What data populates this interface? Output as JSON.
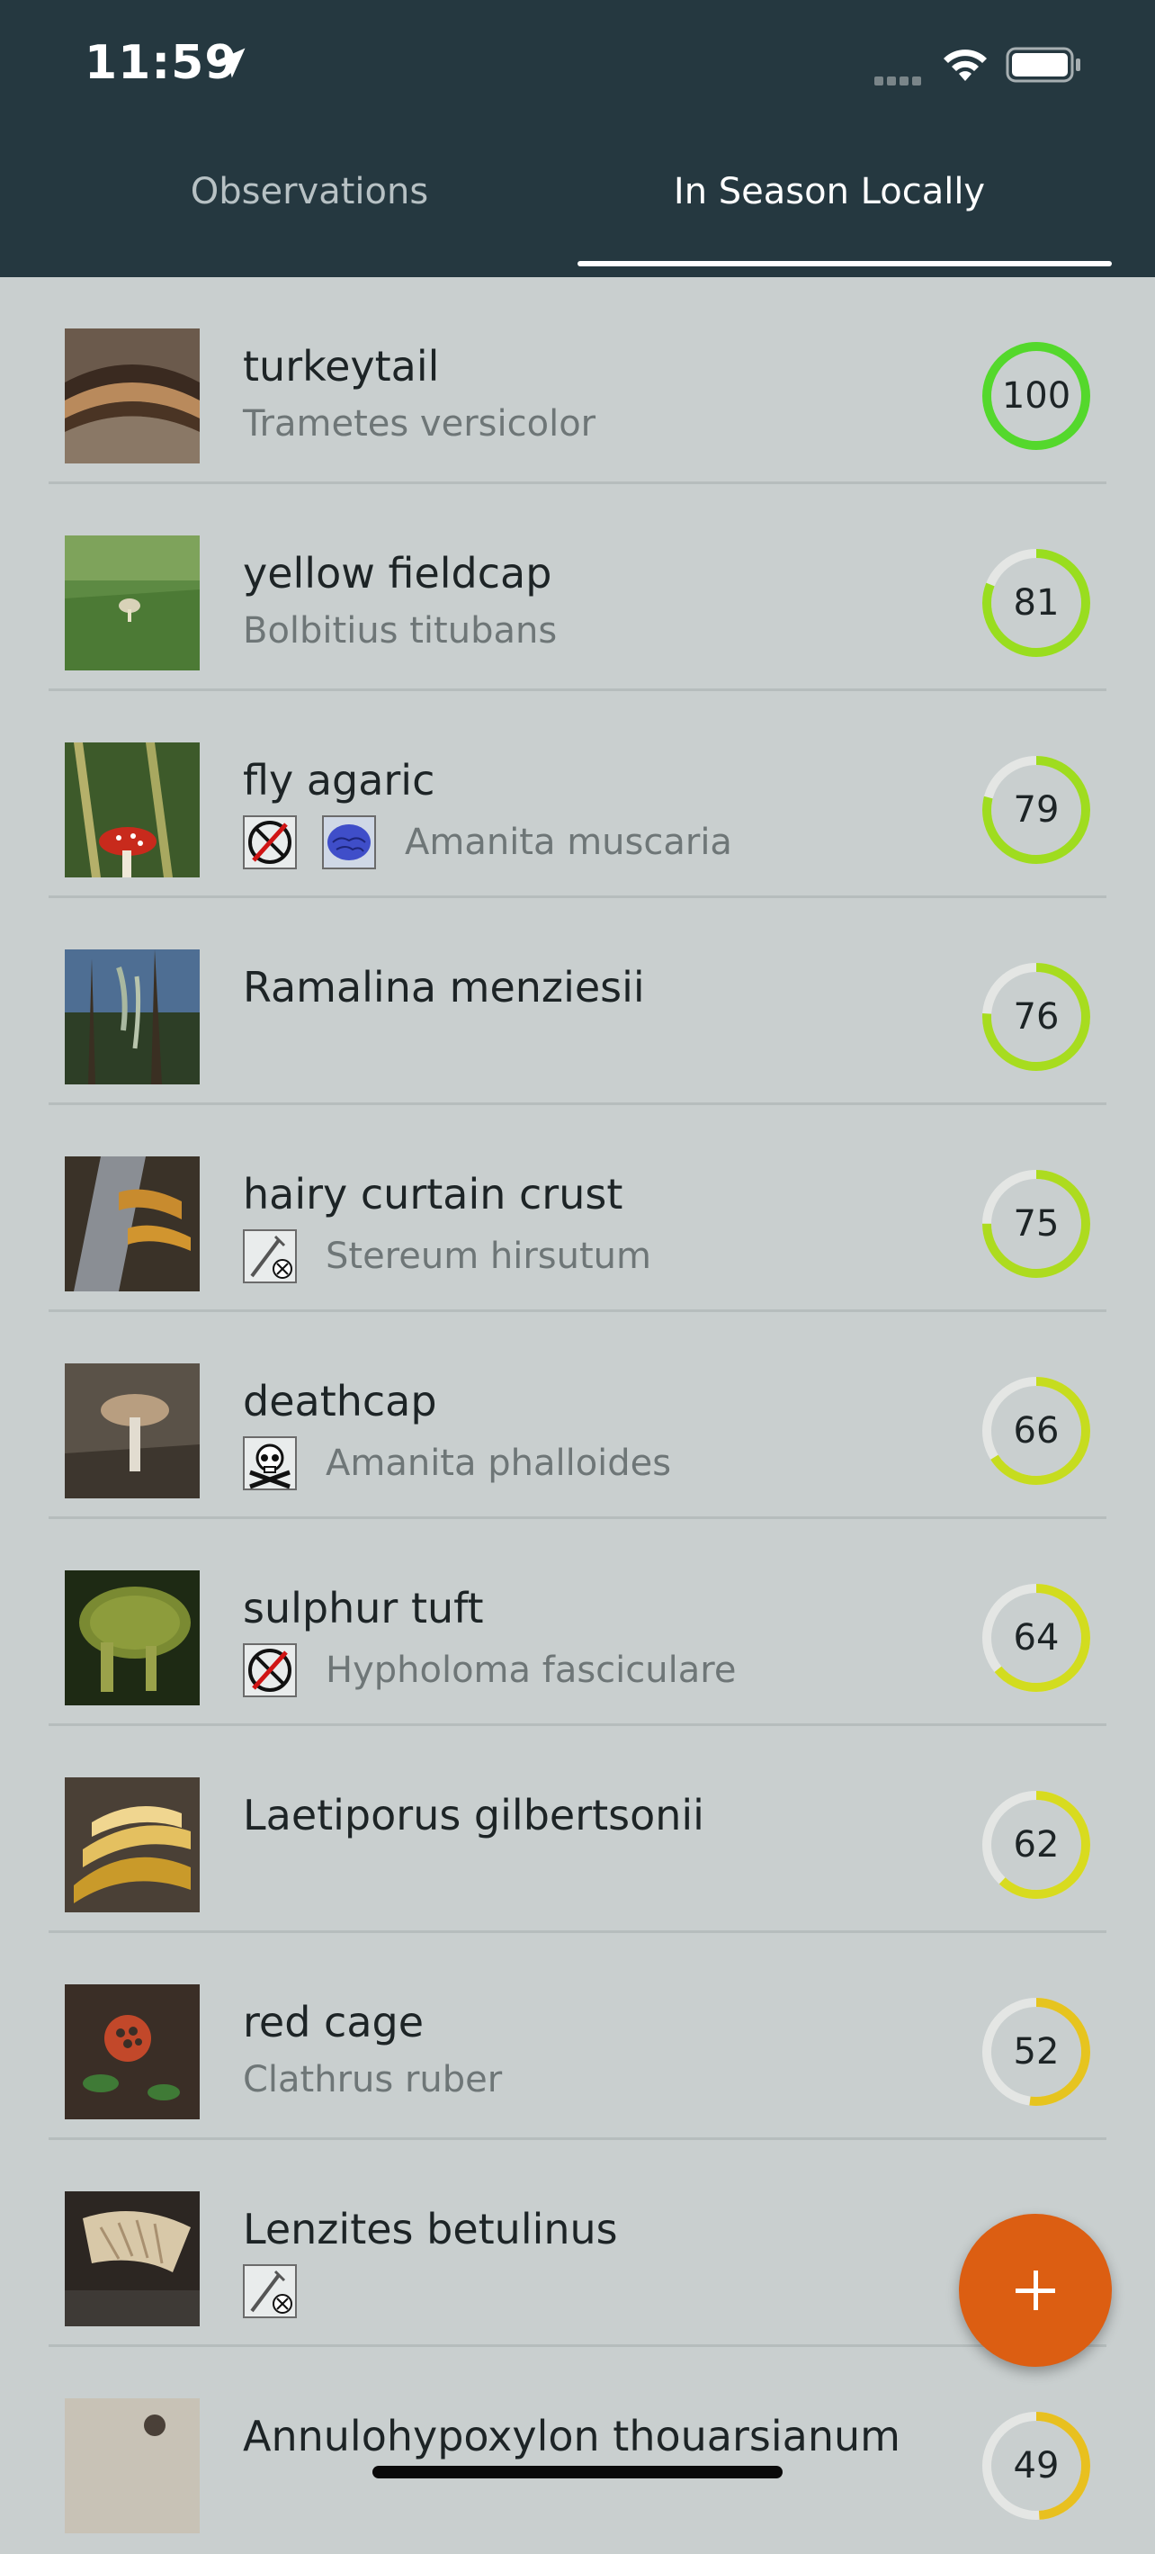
{
  "status_bar": {
    "time": "11:59"
  },
  "tabs": [
    {
      "label": "Observations",
      "active": false
    },
    {
      "label": "In Season Locally",
      "active": true
    }
  ],
  "colors": {
    "header": "#253840",
    "background": "#c9cfcf",
    "fab": "#dc5e12"
  },
  "items": [
    {
      "common": "turkeytail",
      "scientific": "Trametes versicolor",
      "score": "100",
      "badges": []
    },
    {
      "common": "yellow fieldcap",
      "scientific": "Bolbitius titubans",
      "score": "81",
      "badges": []
    },
    {
      "common": "fly agaric",
      "scientific": "Amanita muscaria",
      "score": "79",
      "badges": [
        "not-edible-icon",
        "psychoactive-brain-icon"
      ]
    },
    {
      "common": "Ramalina menziesii",
      "scientific": "",
      "score": "76",
      "badges": []
    },
    {
      "common": "hairy curtain crust",
      "scientific": "Stereum hirsutum",
      "score": "75",
      "badges": [
        "inedible-fork-icon"
      ]
    },
    {
      "common": "deathcap",
      "scientific": "Amanita phalloides",
      "score": "66",
      "badges": [
        "poison-skull-icon"
      ]
    },
    {
      "common": "sulphur tuft",
      "scientific": "Hypholoma fasciculare",
      "score": "64",
      "badges": [
        "not-edible-icon"
      ]
    },
    {
      "common": "Laetiporus gilbertsonii",
      "scientific": "",
      "score": "62",
      "badges": []
    },
    {
      "common": "red cage",
      "scientific": "Clathrus ruber",
      "score": "52",
      "badges": []
    },
    {
      "common": "Lenzites betulinus",
      "scientific": "",
      "score": "",
      "badges": [
        "inedible-fork-icon"
      ]
    },
    {
      "common": "Annulohypoxylon thouarsianum",
      "scientific": "",
      "score": "49",
      "badges": []
    }
  ],
  "fab": {
    "icon": "plus-icon"
  }
}
